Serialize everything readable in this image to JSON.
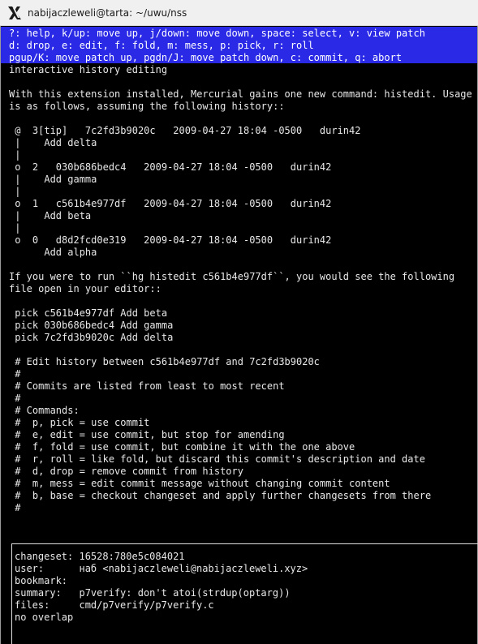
{
  "window": {
    "title": "nabijaczleweli@tarta: ~/uwu/nss",
    "icon": "x11-icon"
  },
  "help": [
    "?: help, k/up: move up, j/down: move down, space: select, v: view patch",
    "d: drop, e: edit, f: fold, m: mess, p: pick, r: roll",
    "pgup/K: move patch up, pgdn/J: move patch down, c: commit, q: abort"
  ],
  "content": [
    "interactive history editing",
    "",
    "With this extension installed, Mercurial gains one new command: histedit. Usage",
    "is as follows, assuming the following history::",
    "",
    " @  3[tip]   7c2fd3b9020c   2009-04-27 18:04 -0500   durin42",
    " |    Add delta",
    " |",
    " o  2   030b686bedc4   2009-04-27 18:04 -0500   durin42",
    " |    Add gamma",
    " |",
    " o  1   c561b4e977df   2009-04-27 18:04 -0500   durin42",
    " |    Add beta",
    " |",
    " o  0   d8d2fcd0e319   2009-04-27 18:04 -0500   durin42",
    "      Add alpha",
    "",
    "If you were to run ``hg histedit c561b4e977df``, you would see the following",
    "file open in your editor::",
    "",
    " pick c561b4e977df Add beta",
    " pick 030b686bedc4 Add gamma",
    " pick 7c2fd3b9020c Add delta",
    "",
    " # Edit history between c561b4e977df and 7c2fd3b9020c",
    " #",
    " # Commits are listed from least to most recent",
    " #",
    " # Commands:",
    " #  p, pick = use commit",
    " #  e, edit = use commit, but stop for amending",
    " #  f, fold = use commit, but combine it with the one above",
    " #  r, roll = like fold, but discard this commit's description and date",
    " #  d, drop = remove commit from history",
    " #  m, mess = edit commit message without changing commit content",
    " #  b, base = checkout changeset and apply further changesets from there",
    " #"
  ],
  "detail": [
    "changeset: 16528:780e5c084021",
    "user:      наб <nabijaczleweli@nabijaczleweli.xyz>",
    "bookmark:",
    "summary:   p7verify: don't atoi(strdup(optarg))",
    "files:     cmd/p7verify/p7verify.c",
    "no overlap"
  ]
}
